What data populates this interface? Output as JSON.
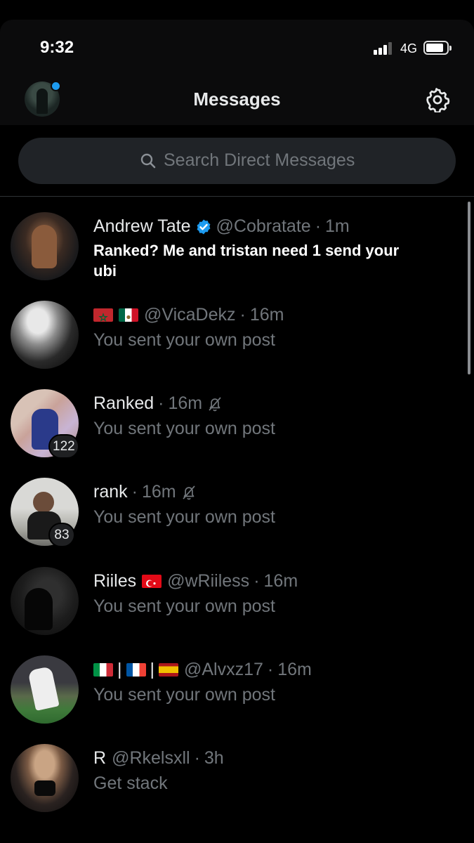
{
  "status_bar": {
    "time": "9:32",
    "network": "4G"
  },
  "header": {
    "title": "Messages"
  },
  "search": {
    "placeholder": "Search Direct Messages"
  },
  "conversations": [
    {
      "name": "Andrew Tate",
      "verified": true,
      "handle": "@Cobratate",
      "time": "1m",
      "preview": "Ranked? Me and tristan need 1 send your ubi",
      "unread": true
    },
    {
      "name": "",
      "flags": [
        "morocco-flag",
        "mexico-flag"
      ],
      "handle": "@VicaDekz",
      "time": "16m",
      "preview": "You sent your own post"
    },
    {
      "name": "Ranked",
      "time": "16m",
      "muted": true,
      "preview": "You sent your own post",
      "badge": "122"
    },
    {
      "name": "rank",
      "time": "16m",
      "muted": true,
      "preview": "You sent your own post",
      "badge": "83"
    },
    {
      "name": "Riiles",
      "flags": [
        "turkey-flag"
      ],
      "handle": "@wRiiless",
      "time": "16m",
      "preview": "You sent your own post"
    },
    {
      "name": "",
      "flags": [
        "italy-flag",
        "|",
        "france-flag",
        "|",
        "spain-flag"
      ],
      "handle": "@Alvxz17",
      "time": "16m",
      "preview": "You sent your own post"
    },
    {
      "name": "R",
      "handle": "@Rkelsxll",
      "time": "3h",
      "preview": "Get stack"
    }
  ],
  "common": {
    "dot": "·",
    "separator": "|"
  },
  "colors": {
    "background": "#000000",
    "accent": "#1d9bf0",
    "secondary_text": "#71767b"
  }
}
